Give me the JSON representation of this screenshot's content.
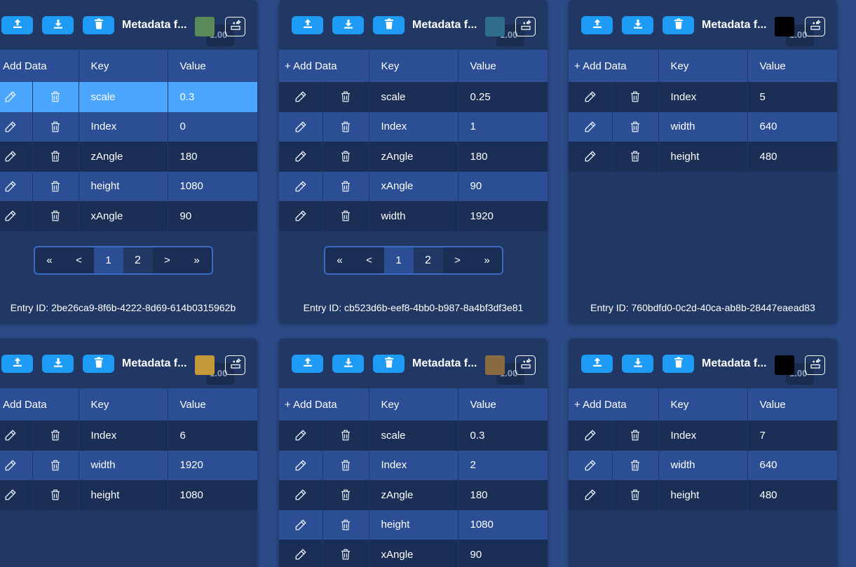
{
  "labels": {
    "title": "Metadata f...",
    "zoom": "1.00",
    "add": "+ Add Data",
    "key": "Key",
    "value": "Value",
    "entry_prefix": "Entry ID: "
  },
  "pager": {
    "first": "«",
    "prev": "<",
    "p1": "1",
    "p2": "2",
    "next": ">",
    "last": "»"
  },
  "cards": [
    {
      "entry_id": "2be26ca9-8f6b-4222-8d69-614b0315962b",
      "thumb_color": "#5a8a5a",
      "rows": [
        [
          "scale",
          "0.3"
        ],
        [
          "Index",
          "0"
        ],
        [
          "zAngle",
          "180"
        ],
        [
          "height",
          "1080"
        ],
        [
          "xAngle",
          "90"
        ]
      ],
      "selected_row": 0
    },
    {
      "entry_id": "cb523d6b-eef8-4bb0-b987-8a4bf3df3e81",
      "thumb_color": "#2f6e8a",
      "rows": [
        [
          "scale",
          "0.25"
        ],
        [
          "Index",
          "1"
        ],
        [
          "zAngle",
          "180"
        ],
        [
          "xAngle",
          "90"
        ],
        [
          "width",
          "1920"
        ]
      ]
    },
    {
      "entry_id": "760bdfd0-0c2d-40ca-ab8b-28447eaead83",
      "thumb_color": "#000000",
      "rows": [
        [
          "Index",
          "5"
        ],
        [
          "width",
          "640"
        ],
        [
          "height",
          "480"
        ]
      ]
    },
    {
      "thumb_color": "#c49a3a",
      "rows": [
        [
          "Index",
          "6"
        ],
        [
          "width",
          "1920"
        ],
        [
          "height",
          "1080"
        ]
      ]
    },
    {
      "thumb_color": "#8a6a40",
      "rows": [
        [
          "scale",
          "0.3"
        ],
        [
          "Index",
          "2"
        ],
        [
          "zAngle",
          "180"
        ],
        [
          "height",
          "1080"
        ],
        [
          "xAngle",
          "90"
        ]
      ]
    },
    {
      "thumb_color": "#000000",
      "rows": [
        [
          "Index",
          "7"
        ],
        [
          "width",
          "640"
        ],
        [
          "height",
          "480"
        ]
      ]
    }
  ]
}
